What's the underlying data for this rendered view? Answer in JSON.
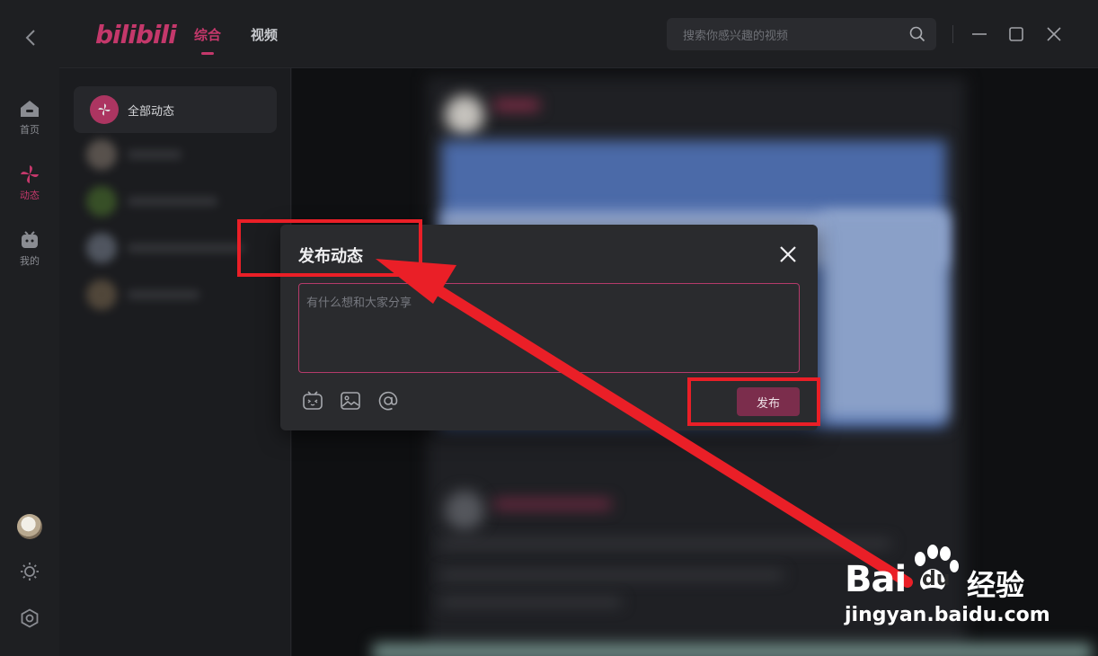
{
  "window": {
    "logo_text": "bilibili",
    "back_icon": "chevron-left-icon",
    "tabs": [
      {
        "label": "综合",
        "active": true
      },
      {
        "label": "视频",
        "active": false
      }
    ],
    "search": {
      "placeholder": "搜索你感兴趣的视频",
      "icon": "search-icon"
    },
    "controls": [
      "minimize-icon",
      "maximize-icon",
      "close-icon"
    ]
  },
  "rail": {
    "items": [
      {
        "label": "首页",
        "icon": "home-tv-icon",
        "active": false
      },
      {
        "label": "动态",
        "icon": "pinwheel-icon",
        "active": true
      },
      {
        "label": "我的",
        "icon": "tv-face-icon",
        "active": false
      }
    ],
    "bottom": [
      "avatar",
      "sun-icon",
      "settings-icon"
    ]
  },
  "sidebar": {
    "active_item": {
      "label": "全部动态",
      "icon": "pinwheel-icon"
    }
  },
  "dialog": {
    "title": "发布动态",
    "placeholder": "有什么想和大家分享",
    "publish_label": "发布",
    "tools": [
      "emoji-icon",
      "image-icon",
      "mention-icon"
    ],
    "close_icon": "close-icon"
  },
  "watermark": {
    "brand": "Bai",
    "brand_suffix": "du",
    "cn": "经验",
    "url": "jingyan.baidu.com"
  },
  "colors": {
    "accent": "#c4386b",
    "publish_button": "#7b2d4c",
    "annotation": "#ea1f27",
    "background": "#17181b"
  }
}
